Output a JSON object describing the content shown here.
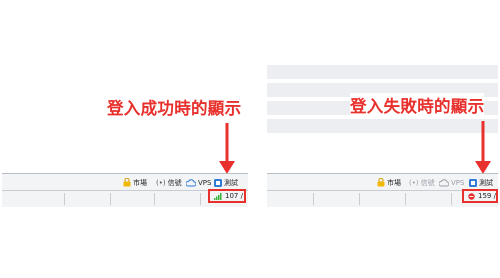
{
  "left": {
    "caption": "登入成功時的顯示",
    "status": {
      "market": "市場",
      "quote": "信號",
      "vps": "VPS",
      "test": "測試",
      "connection": "107 /"
    }
  },
  "right": {
    "caption": "登入失敗時的顯示",
    "status": {
      "market": "市場",
      "quote": "信號",
      "vps": "VPS",
      "test": "測試",
      "connection": "159 /"
    }
  },
  "colors": {
    "accent": "#e8302c",
    "signal_ok": "#3bb33b",
    "signal_fail": "#e8302c",
    "vps_blue": "#2f7bd6",
    "market_gold": "#f2b705"
  },
  "icons": [
    "market-lock-icon",
    "signal-icon",
    "vps-cloud-icon",
    "test-icon",
    "signal-bars-icon",
    "error-dot-icon",
    "down-arrow-icon"
  ]
}
